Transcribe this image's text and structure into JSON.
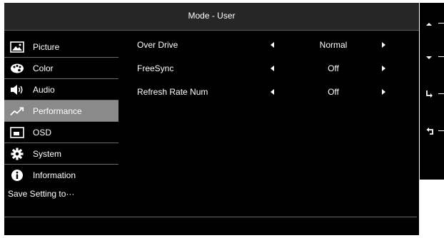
{
  "title": "Mode - User",
  "sidebar": {
    "items": [
      {
        "label": "Picture",
        "icon": "picture-icon"
      },
      {
        "label": "Color",
        "icon": "palette-icon"
      },
      {
        "label": "Audio",
        "icon": "speaker-icon"
      },
      {
        "label": "Performance",
        "icon": "performance-icon",
        "active": true
      },
      {
        "label": "OSD",
        "icon": "osd-icon"
      },
      {
        "label": "System",
        "icon": "gear-icon"
      },
      {
        "label": "Information",
        "icon": "info-icon"
      }
    ],
    "save_label": "Save Setting to···"
  },
  "settings": [
    {
      "label": "Over Drive",
      "value": "Normal"
    },
    {
      "label": "FreeSync",
      "value": "Off"
    },
    {
      "label": "Refresh Rate Num",
      "value": "Off"
    }
  ],
  "side_buttons": [
    "up-icon",
    "down-icon",
    "enter-icon",
    "back-icon"
  ],
  "colors": {
    "osd_bg": "#000000",
    "title_bg": "#262626",
    "active_bg": "#8a8a8a"
  }
}
